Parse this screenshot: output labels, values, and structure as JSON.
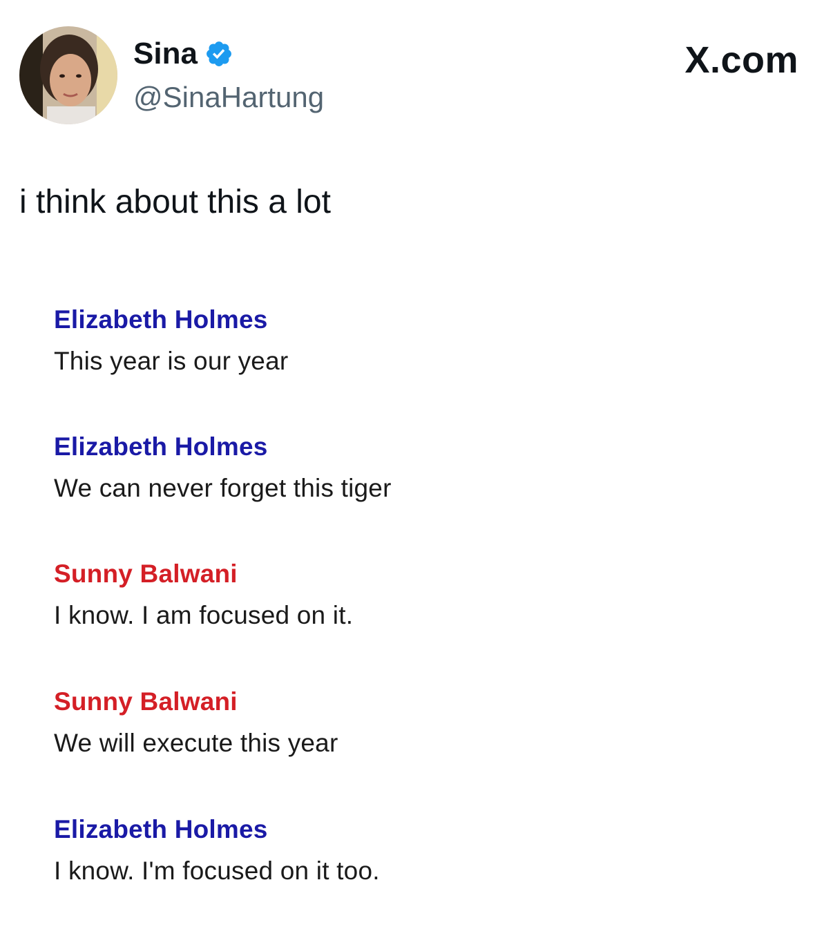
{
  "author": {
    "name": "Sina",
    "handle": "@SinaHartung",
    "verified_icon": "verified-badge-icon",
    "verified_color": "#1d9bf0"
  },
  "brand": "X.com",
  "tweet_text": "i think about this a lot",
  "conversation": [
    {
      "sender": "Elizabeth Holmes",
      "sender_color": "#1a1aa6",
      "text": "This year is our year"
    },
    {
      "sender": "Elizabeth Holmes",
      "sender_color": "#1a1aa6",
      "text": "We can never forget this tiger"
    },
    {
      "sender": "Sunny Balwani",
      "sender_color": "#d41f26",
      "text": "I know. I am focused on it."
    },
    {
      "sender": "Sunny Balwani",
      "sender_color": "#d41f26",
      "text": "We will execute this year"
    },
    {
      "sender": "Elizabeth Holmes",
      "sender_color": "#1a1aa6",
      "text": "I know. I'm focused on it too."
    }
  ]
}
